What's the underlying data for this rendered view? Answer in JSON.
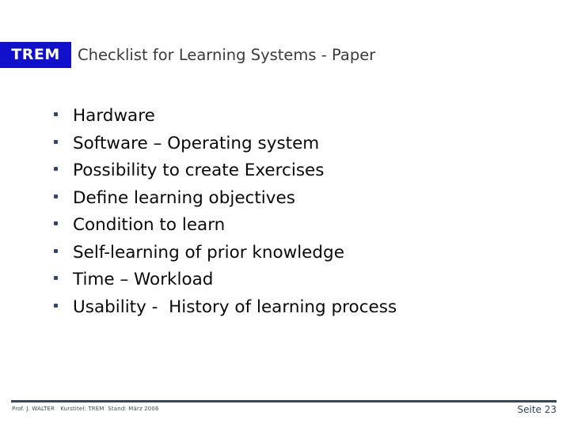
{
  "header": {
    "brand": "TREM",
    "brand_bg_color": "#1111CC",
    "brand_text_color": "#FFFFFF",
    "title": "Checklist for Learning Systems - Paper",
    "title_color": "#3A3A3A"
  },
  "content": {
    "bullet_color": "#33476E",
    "text_color": "#0A0A0A",
    "bullets": [
      {
        "label": "Hardware"
      },
      {
        "label": "Software – Operating system"
      },
      {
        "label": "Possibility to create Exercises"
      },
      {
        "label": "Define learning objectives"
      },
      {
        "label": "Condition to learn"
      },
      {
        "label": "Self-learning of prior knowledge"
      },
      {
        "label": "Time – Workload"
      },
      {
        "label": "Usability -  History of learning process"
      }
    ]
  },
  "footer": {
    "rule_color": "#31475E",
    "credit": "Prof. J. WALTER   Kurstitel: TREM  Stand: März 2006",
    "page_label": "Seite 23"
  }
}
